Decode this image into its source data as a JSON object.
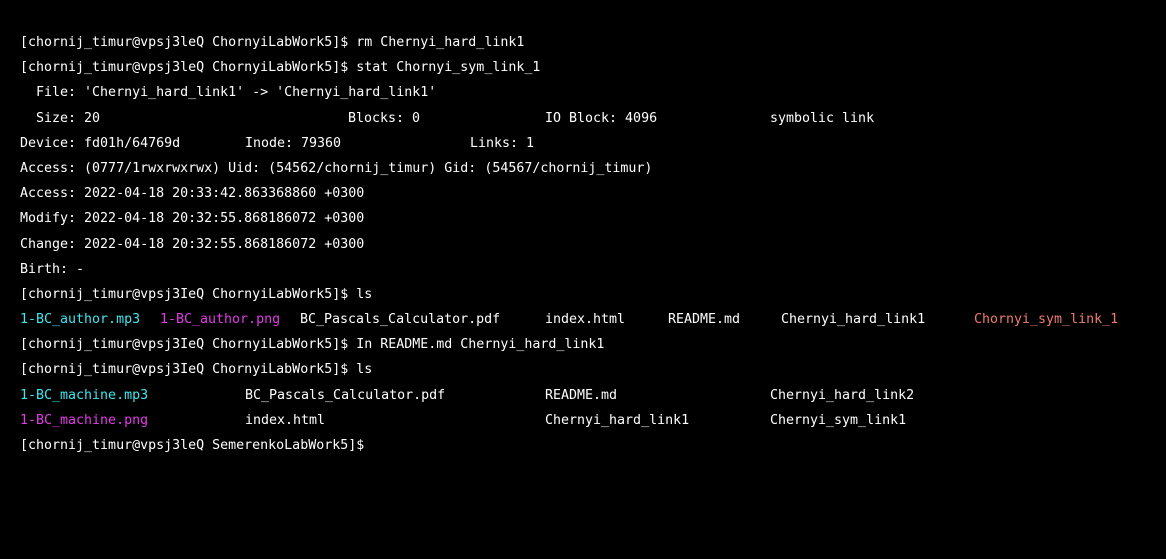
{
  "colors": {
    "background": "#000000",
    "text": "#ffffff",
    "audio_file": "#3ee6ee",
    "image_file": "#e23be6",
    "symlink_broken": "#f07a6c"
  },
  "lines": {
    "l1": "[chornij_timur@vpsj3leQ ChornyiLabWork5]$ rm Chernyi_hard_link1",
    "l2": "[chornij_timur@vpsj3leQ ChornyiLabWork5]$ stat Chornyi_sym_link_1",
    "l3": "  File: 'Chernyi_hard_link1' -> 'Chernyi_hard_link1'",
    "l4a": "  Size: 20",
    "l4b": "Blocks: 0",
    "l4c": "IO Block: 4096",
    "l4d": "symbolic link",
    "l5a": "Device: fd01h/64769d",
    "l5b": "Inode: 79360",
    "l5c": "Links: 1",
    "l6": "Access: (0777/1rwxrwxrwx) Uid: (54562/chornij_timur) Gid: (54567/chornij_timur)",
    "l7": "Access: 2022-04-18 20:33:42.863368860 +0300",
    "l8": "Modify: 2022-04-18 20:32:55.868186072 +0300",
    "l9": "Change: 2022-04-18 20:32:55.868186072 +0300",
    "l10": "Birth: -",
    "l11": "[chornij_timur@vpsj3IeQ ChornyiLabWork5]$ ls",
    "l12": {
      "f1": "1-BC_author.mp3",
      "f2": "1-BC_author.png",
      "f3": "BC_Pascals_Calculator.pdf",
      "f4": "index.html",
      "f5": "README.md",
      "f6": "Chernyi_hard_link1",
      "f7": "Chornyi_sym_link_1"
    },
    "l13": "[chornij_timur@vpsj3IeQ ChornyiLabWork5]$ In README.md Chernyi_hard_link1",
    "l14": "[chornij_timur@vpsj3IeQ ChornyiLabWork5]$ ls",
    "l15": {
      "f1": "1-BC_machine.mp3",
      "f2": "BC_Pascals_Calculator.pdf",
      "f3": "README.md",
      "f4": "Chernyi_hard_link2"
    },
    "l16": {
      "f1": "1-BC_machine.png",
      "f2": "index.html",
      "f3": "Chernyi_hard_link1",
      "f4": "Chernyi_sym_link1"
    },
    "l17": "[chornij_timur@vpsj3leQ SemerenkoLabWork5]$"
  }
}
